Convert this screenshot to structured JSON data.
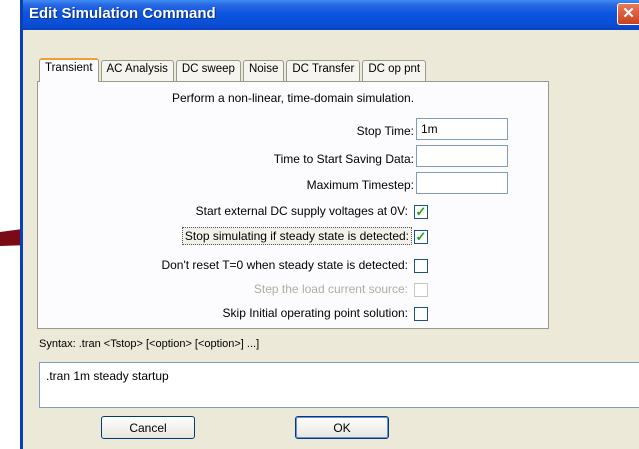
{
  "window": {
    "title": "Edit Simulation Command",
    "close_label": "✕"
  },
  "tabs": [
    "Transient",
    "AC Analysis",
    "DC sweep",
    "Noise",
    "DC Transfer",
    "DC op pnt"
  ],
  "transient": {
    "description": "Perform a non-linear, time-domain simulation.",
    "stop_time_label": "Stop Time:",
    "stop_time_value": "1m",
    "start_saving_label": "Time to Start Saving Data:",
    "start_saving_value": "",
    "max_timestep_label": "Maximum Timestep:",
    "max_timestep_value": "",
    "options": [
      {
        "label": "Start external DC supply voltages at 0V:",
        "checked": true,
        "disabled": false
      },
      {
        "label": "Stop simulating if steady state is detected:",
        "checked": true,
        "disabled": false
      },
      {
        "label": "Don't reset T=0 when steady state is detected:",
        "checked": false,
        "disabled": false
      },
      {
        "label": "Step the load current source:",
        "checked": false,
        "disabled": true
      },
      {
        "label": "Skip Initial operating point solution:",
        "checked": false,
        "disabled": false
      }
    ]
  },
  "syntax": "Syntax:  .tran <Tstop> [<option> [<option>] ...]",
  "command": ".tran 1m steady startup",
  "buttons": {
    "cancel": "Cancel",
    "ok": "OK"
  },
  "colors": {
    "titlebar": "#0a4fd6",
    "arrow": "#7a0a16",
    "check": "#21a121"
  }
}
